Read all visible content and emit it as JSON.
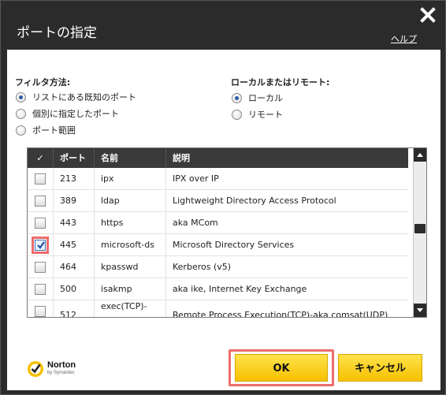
{
  "window": {
    "title": "ポートの指定",
    "help_label": "ヘルプ"
  },
  "filter": {
    "title": "フィルタ方法:",
    "options": [
      {
        "label": "リストにある既知のポート",
        "checked": true
      },
      {
        "label": "個別に指定したポート",
        "checked": false
      },
      {
        "label": "ポート範囲",
        "checked": false
      }
    ]
  },
  "scope": {
    "title": "ローカルまたはリモート:",
    "options": [
      {
        "label": "ローカル",
        "checked": true
      },
      {
        "label": "リモート",
        "checked": false
      }
    ]
  },
  "table": {
    "columns": [
      "✓",
      "ポート",
      "名前",
      "説明"
    ],
    "rows": [
      {
        "checked": false,
        "port": "213",
        "name": "ipx",
        "description": "IPX over IP"
      },
      {
        "checked": false,
        "port": "389",
        "name": "ldap",
        "description": "Lightweight Directory Access Protocol"
      },
      {
        "checked": false,
        "port": "443",
        "name": "https",
        "description": "aka MCom"
      },
      {
        "checked": true,
        "port": "445",
        "name": "microsoft-ds",
        "description": "Microsoft Directory Services"
      },
      {
        "checked": false,
        "port": "464",
        "name": "kpasswd",
        "description": "Kerberos (v5)"
      },
      {
        "checked": false,
        "port": "500",
        "name": "isakmp",
        "description": "aka ike, Internet Key Exchange"
      },
      {
        "checked": false,
        "port": "512",
        "name": "exec(TCP)-",
        "description": "Remote Process Execution(TCP)-aka comsat(UDP)"
      }
    ]
  },
  "brand": {
    "name": "Norton",
    "sub": "by Symantec"
  },
  "buttons": {
    "ok_label": "OK",
    "cancel_label": "キャンセル"
  },
  "colors": {
    "accent_yellow": "#f6c000",
    "highlight_red": "#ee6c6c",
    "dark_chrome": "#2b2b2b"
  }
}
